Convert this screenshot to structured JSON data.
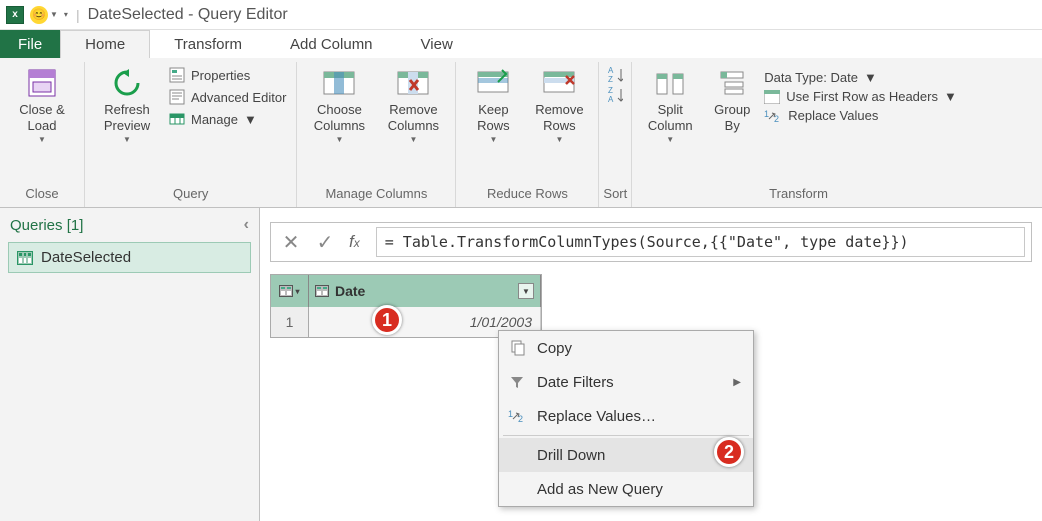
{
  "titlebar": {
    "app_title": "DateSelected - Query Editor"
  },
  "tabs": {
    "file": "File",
    "home": "Home",
    "transform": "Transform",
    "add_column": "Add Column",
    "view": "View"
  },
  "ribbon": {
    "close": {
      "close_load": "Close &\nLoad",
      "group": "Close"
    },
    "query": {
      "refresh": "Refresh\nPreview",
      "properties": "Properties",
      "advanced": "Advanced Editor",
      "manage": "Manage",
      "group": "Query"
    },
    "manage_cols": {
      "choose": "Choose\nColumns",
      "remove": "Remove\nColumns",
      "group": "Manage Columns"
    },
    "reduce_rows": {
      "keep": "Keep\nRows",
      "remove": "Remove\nRows",
      "group": "Reduce Rows"
    },
    "sort": {
      "group": "Sort"
    },
    "transform": {
      "split": "Split\nColumn",
      "groupby": "Group\nBy",
      "datatype": "Data Type: Date",
      "first_row": "Use First Row as Headers",
      "replace": "Replace Values",
      "group": "Transform"
    }
  },
  "queries_pane": {
    "header": "Queries [1]",
    "item": "DateSelected"
  },
  "formula": "= Table.TransformColumnTypes(Source,{{\"Date\", type date}})",
  "table": {
    "col_header": "Date",
    "row_index": "1",
    "row_value": "1/01/2003"
  },
  "context_menu": {
    "copy": "Copy",
    "date_filters": "Date Filters",
    "replace_values": "Replace Values…",
    "drill_down": "Drill Down",
    "add_new_query": "Add as New Query"
  },
  "badges": {
    "b1": "1",
    "b2": "2"
  }
}
